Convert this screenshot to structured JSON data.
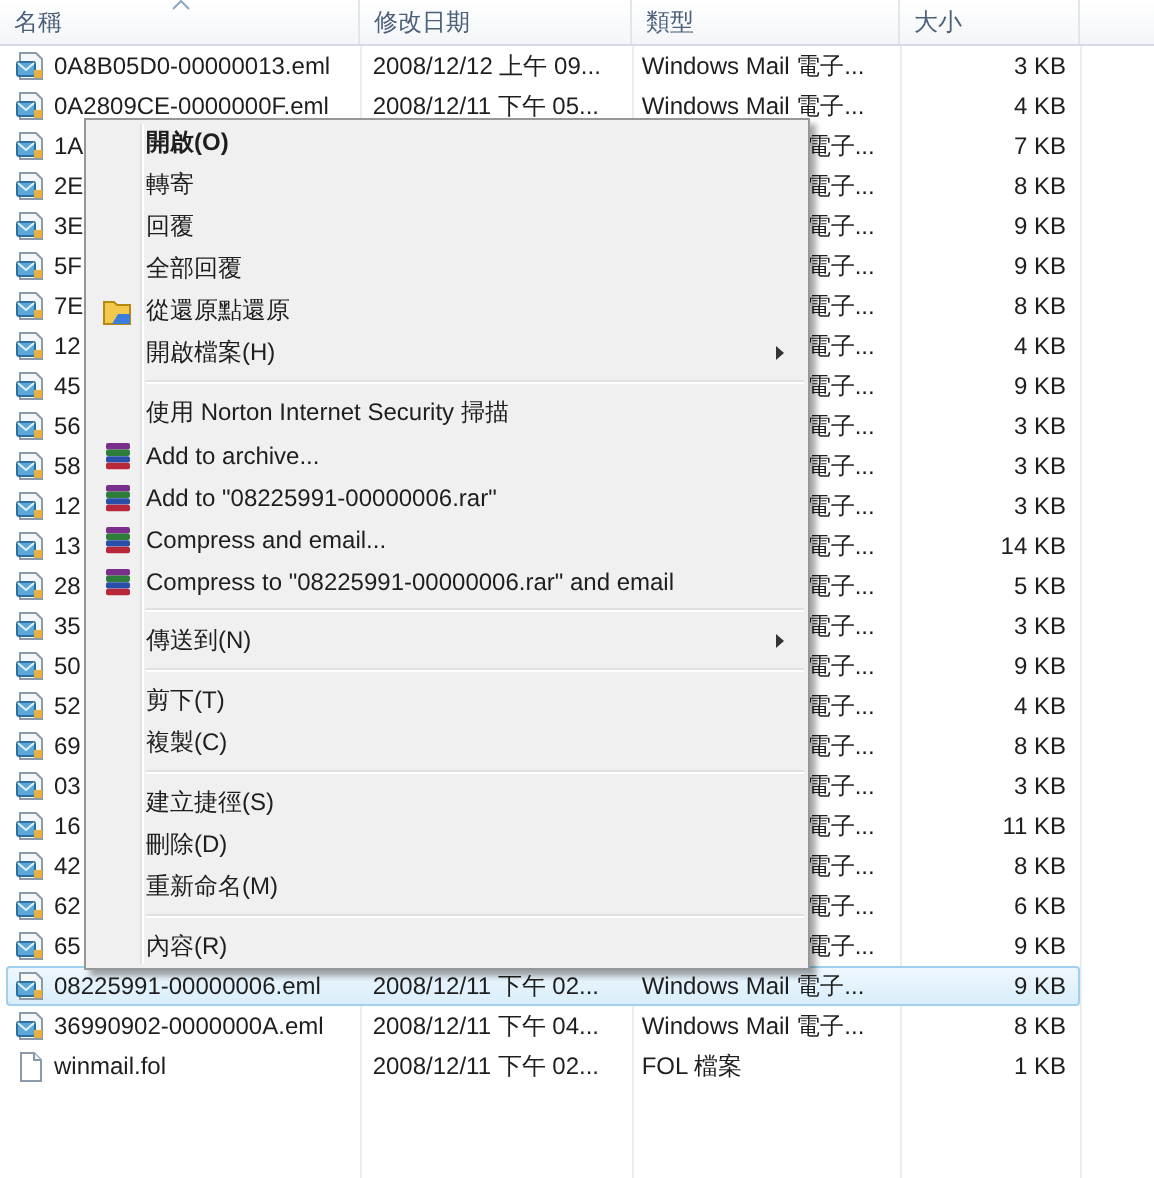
{
  "columns": [
    {
      "label": "名稱",
      "sorted": true
    },
    {
      "label": "修改日期",
      "sorted": false
    },
    {
      "label": "類型",
      "sorted": false
    },
    {
      "label": "大小",
      "sorted": false
    }
  ],
  "rows": [
    {
      "kind": "mail",
      "name": "0A8B05D0-00000013.eml",
      "date": "2008/12/12 上午 09...",
      "type": "Windows Mail 電子...",
      "size": "3 KB",
      "covered": false,
      "selected": false
    },
    {
      "kind": "mail",
      "name": "0A2809CE-0000000F.eml",
      "date": "2008/12/11 下午 05...",
      "type": "Windows Mail 電子...",
      "size": "4 KB",
      "covered": false,
      "selected": false
    },
    {
      "kind": "mail",
      "name": "1A",
      "type": "電子...",
      "size": "7 KB",
      "covered": true,
      "selected": false
    },
    {
      "kind": "mail",
      "name": "2E",
      "type": "電子...",
      "size": "8 KB",
      "covered": true,
      "selected": false
    },
    {
      "kind": "mail",
      "name": "3E",
      "type": "電子...",
      "size": "9 KB",
      "covered": true,
      "selected": false
    },
    {
      "kind": "mail",
      "name": "5F",
      "type": "電子...",
      "size": "9 KB",
      "covered": true,
      "selected": false
    },
    {
      "kind": "mail",
      "name": "7E",
      "type": "電子...",
      "size": "8 KB",
      "covered": true,
      "selected": false
    },
    {
      "kind": "mail",
      "name": "12",
      "type": "電子...",
      "size": "4 KB",
      "covered": true,
      "selected": false
    },
    {
      "kind": "mail",
      "name": "45",
      "type": "電子...",
      "size": "9 KB",
      "covered": true,
      "selected": false
    },
    {
      "kind": "mail",
      "name": "56",
      "type": "電子...",
      "size": "3 KB",
      "covered": true,
      "selected": false
    },
    {
      "kind": "mail",
      "name": "58",
      "type": "電子...",
      "size": "3 KB",
      "covered": true,
      "selected": false
    },
    {
      "kind": "mail",
      "name": "12",
      "type": "電子...",
      "size": "3 KB",
      "covered": true,
      "selected": false
    },
    {
      "kind": "mail",
      "name": "13",
      "type": "電子...",
      "size": "14 KB",
      "covered": true,
      "selected": false
    },
    {
      "kind": "mail",
      "name": "28",
      "type": "電子...",
      "size": "5 KB",
      "covered": true,
      "selected": false
    },
    {
      "kind": "mail",
      "name": "35",
      "type": "電子...",
      "size": "3 KB",
      "covered": true,
      "selected": false
    },
    {
      "kind": "mail",
      "name": "50",
      "type": "電子...",
      "size": "9 KB",
      "covered": true,
      "selected": false
    },
    {
      "kind": "mail",
      "name": "52",
      "type": "電子...",
      "size": "4 KB",
      "covered": true,
      "selected": false
    },
    {
      "kind": "mail",
      "name": "69",
      "type": "電子...",
      "size": "8 KB",
      "covered": true,
      "selected": false
    },
    {
      "kind": "mail",
      "name": "03",
      "type": "電子...",
      "size": "3 KB",
      "covered": true,
      "selected": false
    },
    {
      "kind": "mail",
      "name": "16",
      "type": "電子...",
      "size": "11 KB",
      "covered": true,
      "selected": false
    },
    {
      "kind": "mail",
      "name": "42",
      "type": "電子...",
      "size": "8 KB",
      "covered": true,
      "selected": false
    },
    {
      "kind": "mail",
      "name": "62",
      "type": "電子...",
      "size": "6 KB",
      "covered": true,
      "selected": false
    },
    {
      "kind": "mail",
      "name": "65",
      "type": "電子...",
      "size": "9 KB",
      "covered": true,
      "selected": false
    },
    {
      "kind": "mail",
      "name": "08225991-00000006.eml",
      "date": "2008/12/11 下午 02...",
      "type": "Windows Mail 電子...",
      "size": "9 KB",
      "covered": false,
      "selected": true
    },
    {
      "kind": "mail",
      "name": "36990902-0000000A.eml",
      "date": "2008/12/11 下午 04...",
      "type": "Windows Mail 電子...",
      "size": "8 KB",
      "covered": false,
      "selected": false
    },
    {
      "kind": "file",
      "name": "winmail.fol",
      "date": "2008/12/11 下午 02...",
      "type": "FOL 檔案",
      "size": "1 KB",
      "covered": false,
      "selected": false
    }
  ],
  "context_menu": [
    {
      "kind": "item",
      "label": "開啟(O)",
      "bold": true
    },
    {
      "kind": "item",
      "label": "轉寄"
    },
    {
      "kind": "item",
      "label": "回覆"
    },
    {
      "kind": "item",
      "label": "全部回覆"
    },
    {
      "kind": "folder",
      "label": "從還原點還原"
    },
    {
      "kind": "item",
      "label": "開啟檔案(H)",
      "submenu": true
    },
    {
      "kind": "separator"
    },
    {
      "kind": "item",
      "label": "使用 Norton Internet Security 掃描"
    },
    {
      "kind": "archive",
      "label": "Add to archive..."
    },
    {
      "kind": "archive",
      "label": "Add to \"08225991-00000006.rar\""
    },
    {
      "kind": "archive",
      "label": "Compress and email..."
    },
    {
      "kind": "archive",
      "label": "Compress to \"08225991-00000006.rar\" and email"
    },
    {
      "kind": "separator"
    },
    {
      "kind": "item",
      "label": "傳送到(N)",
      "submenu": true
    },
    {
      "kind": "separator"
    },
    {
      "kind": "item",
      "label": "剪下(T)"
    },
    {
      "kind": "item",
      "label": "複製(C)"
    },
    {
      "kind": "separator"
    },
    {
      "kind": "item",
      "label": "建立捷徑(S)"
    },
    {
      "kind": "item",
      "label": "刪除(D)"
    },
    {
      "kind": "item",
      "label": "重新命名(M)"
    },
    {
      "kind": "separator"
    },
    {
      "kind": "item",
      "label": "內容(R)"
    }
  ]
}
